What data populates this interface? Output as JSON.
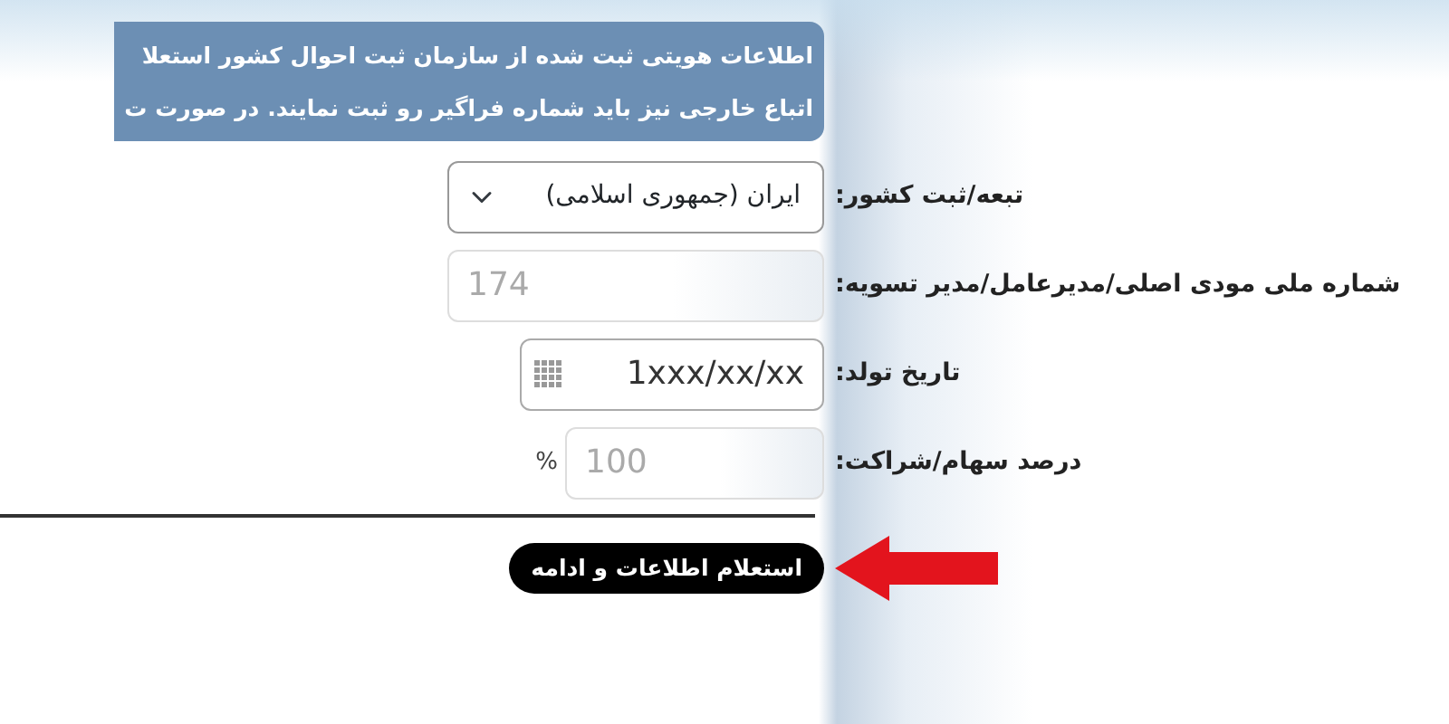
{
  "notice": {
    "lines": [
      "اطلاعات هویتی ثبت شده از سازمان ثبت احوال کشور استعلا",
      "اتباع خارجی نیز باید شماره فراگیر رو ثبت نمایند. در صورت ت"
    ]
  },
  "fields": [
    {
      "kind": "select",
      "label": "تبعه/ثبت کشور:",
      "value": "ایران (جمهوری اسلامی)",
      "disabled": false
    },
    {
      "kind": "text",
      "label": "شماره ملی مودی اصلی/مدیرعامل/مدیر تسویه:",
      "value": "174",
      "disabled": true
    },
    {
      "kind": "date",
      "label": "تاریخ تولد:",
      "value": "1xxx/xx/xx",
      "disabled": false
    },
    {
      "kind": "percent",
      "label": "درصد سهام/شراکت:",
      "value": "100",
      "suffix": "%",
      "disabled": true
    }
  ],
  "submit_button": {
    "label": "استعلام اطلاعات و ادامه"
  }
}
